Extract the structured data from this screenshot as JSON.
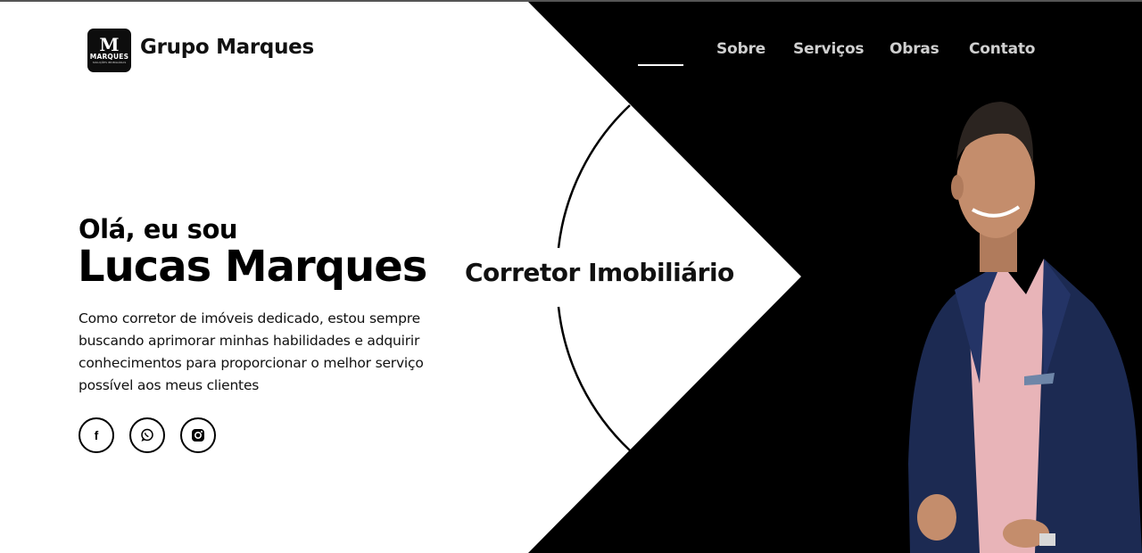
{
  "brand": {
    "name": "Grupo Marques",
    "logo_mark": "M",
    "logo_text": "MARQUES",
    "logo_sub": "SOLUÇÕES IMOBILIÁRIAS"
  },
  "nav": {
    "items": [
      "Sobre",
      "Serviços",
      "Obras",
      "Contato"
    ]
  },
  "hero": {
    "greeting": "Olá, eu sou",
    "name": "Lucas Marques",
    "role": "Corretor Imobiliário",
    "description": "Como corretor de imóveis dedicado, estou sempre buscando aprimorar minhas habilidades e adquirir conhecimentos para proporcionar o melhor serviço possível aos meus clientes"
  },
  "social": [
    "facebook-icon",
    "whatsapp-icon",
    "instagram-icon"
  ],
  "colors": {
    "dark": "#000000",
    "light": "#ffffff",
    "nav_text": "#cfcfcf",
    "suit": "#1c2a52",
    "shirt": "#e8b4b8"
  }
}
